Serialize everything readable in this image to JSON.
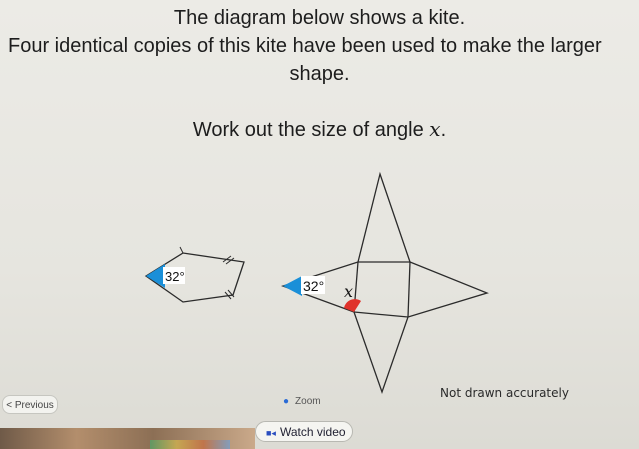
{
  "instructions": {
    "line1": "The diagram below shows a kite.",
    "line2": "Four identical copies of this kite have been used to make the larger",
    "line3": "shape.",
    "question_prefix": "Work out the size of angle ",
    "question_var": "x",
    "question_suffix": "."
  },
  "diagram": {
    "kite_angle_label": "32°",
    "shape_angle_label": "32°",
    "unknown_angle_label": "x",
    "note": "Not drawn accurately",
    "colors": {
      "angle_blue": "#1a8fd8",
      "angle_red": "#e0322a",
      "line": "#2b2b2b"
    }
  },
  "controls": {
    "previous_label": "< Previous",
    "zoom_label": "Zoom",
    "zoom_icon": "search-icon",
    "watch_video_label": "Watch video",
    "video_icon": "video-icon"
  }
}
